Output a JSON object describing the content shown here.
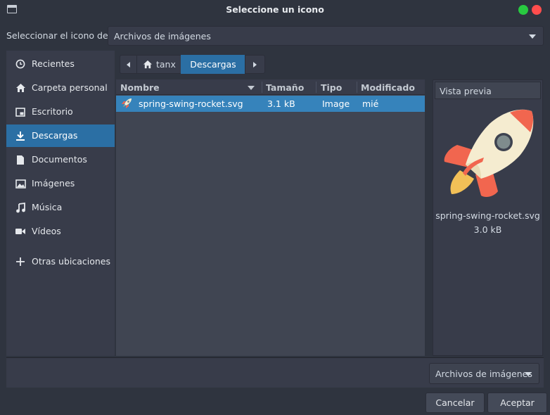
{
  "window": {
    "title": "Seleccione un icono"
  },
  "selector": {
    "label": "Seleccionar el icono de:",
    "value": "Archivos de imágenes"
  },
  "sidebar": {
    "items": [
      {
        "label": "Recientes",
        "icon": "clock-icon"
      },
      {
        "label": "Carpeta personal",
        "icon": "home-icon"
      },
      {
        "label": "Escritorio",
        "icon": "desktop-icon"
      },
      {
        "label": "Descargas",
        "icon": "download-icon",
        "active": true
      },
      {
        "label": "Documentos",
        "icon": "document-icon"
      },
      {
        "label": "Imágenes",
        "icon": "image-icon"
      },
      {
        "label": "Música",
        "icon": "music-icon"
      },
      {
        "label": "Vídeos",
        "icon": "video-icon"
      },
      {
        "label": "Otras ubicaciones",
        "icon": "plus-icon"
      }
    ]
  },
  "pathbar": {
    "home": "tanx",
    "current": "Descargas"
  },
  "filelist": {
    "columns": [
      "Nombre",
      "Tamaño",
      "Tipo",
      "Modificado"
    ],
    "rows": [
      {
        "name": "spring-swing-rocket.svg",
        "size": "3.1 kB",
        "type": "Image",
        "modified": "mié"
      }
    ]
  },
  "preview": {
    "header": "Vista previa",
    "name": "spring-swing-rocket.svg",
    "size": "3.0 kB"
  },
  "filter": {
    "value": "Archivos de imágenes"
  },
  "buttons": {
    "cancel": "Cancelar",
    "accept": "Aceptar"
  },
  "colors": {
    "accent": "#2b6fa4",
    "selection": "#3683bb",
    "rocket_body": "#f5ecd0",
    "rocket_fin": "#f1664f",
    "rocket_flame": "#f2c057",
    "rocket_window": "#7f8c8d"
  }
}
